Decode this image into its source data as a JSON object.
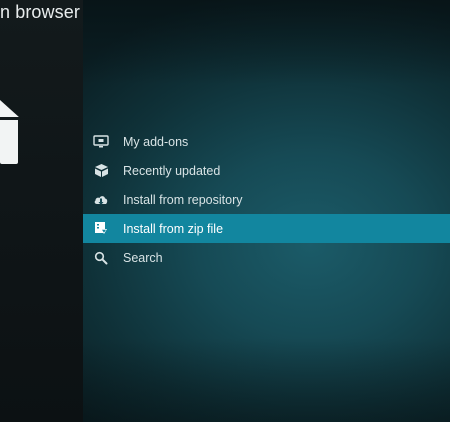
{
  "header": {
    "title": "n browser"
  },
  "menu": {
    "items": [
      {
        "label": "My add-ons",
        "icon": "monitor-icon"
      },
      {
        "label": "Recently updated",
        "icon": "box-icon"
      },
      {
        "label": "Install from repository",
        "icon": "cloud-download-icon"
      },
      {
        "label": "Install from zip file",
        "icon": "zip-install-icon",
        "selected": true
      },
      {
        "label": "Search",
        "icon": "search-icon"
      }
    ]
  },
  "colors": {
    "selected_bg": "#12869f",
    "text": "#d8e3e5",
    "left_panel": "#131a1c",
    "main_bg": "#164a55"
  }
}
